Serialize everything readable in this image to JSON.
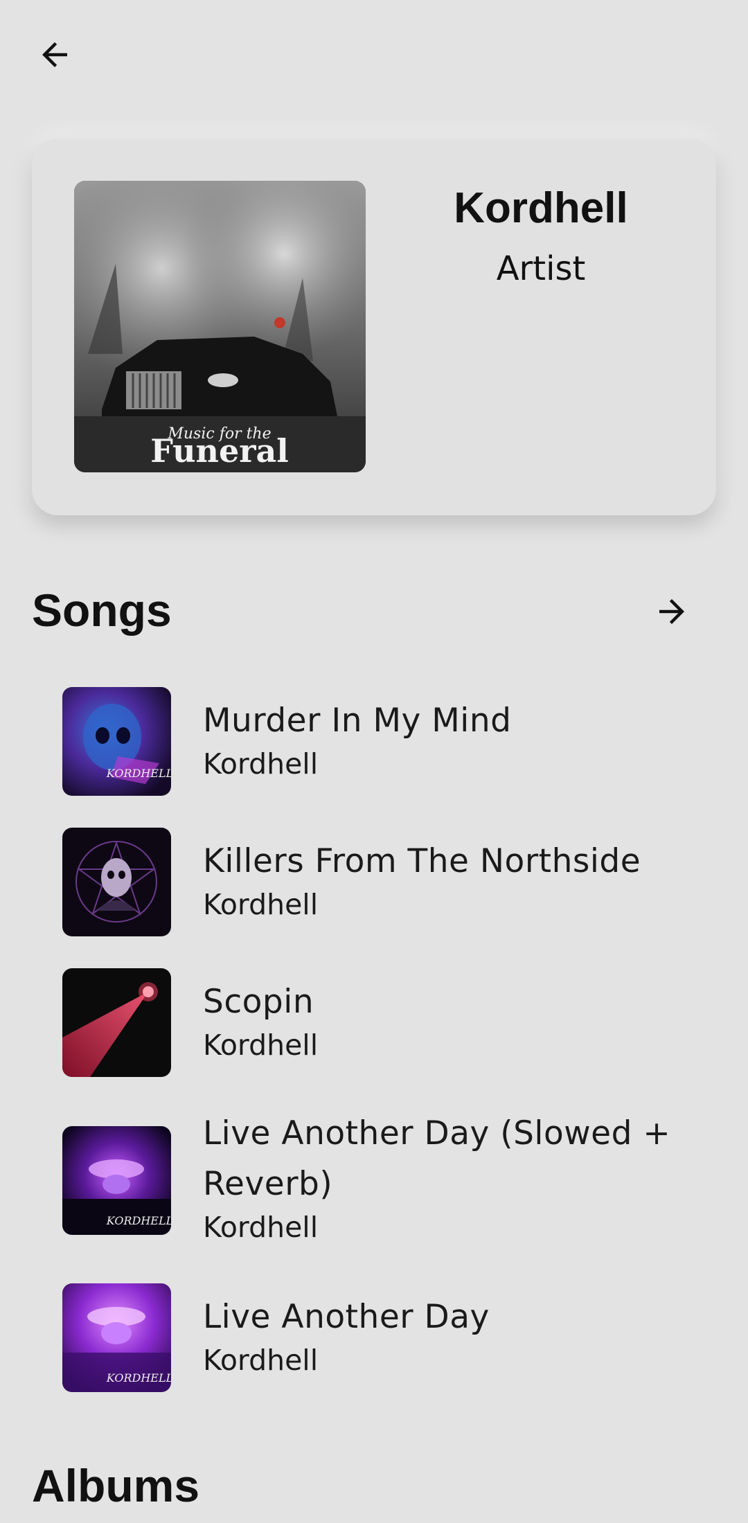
{
  "header": {
    "back_icon": "arrow-left-icon"
  },
  "artist": {
    "name": "Kordhell",
    "role": "Artist",
    "artwork_text_1": "Music for the",
    "artwork_text_2": "Funeral"
  },
  "songs_section": {
    "title": "Songs",
    "more_icon": "arrow-right-icon",
    "items": [
      {
        "title": "Murder In My Mind",
        "artist": "Kordhell"
      },
      {
        "title": "Killers From The Northside",
        "artist": "Kordhell"
      },
      {
        "title": "Scopin",
        "artist": "Kordhell"
      },
      {
        "title": "Live Another Day (Slowed + Reverb)",
        "artist": "Kordhell"
      },
      {
        "title": "Live Another Day",
        "artist": "Kordhell"
      }
    ]
  },
  "albums_section": {
    "title": "Albums"
  },
  "colors": {
    "background": "#e3e3e3",
    "card": "#e1e1e1",
    "text": "#111111"
  }
}
